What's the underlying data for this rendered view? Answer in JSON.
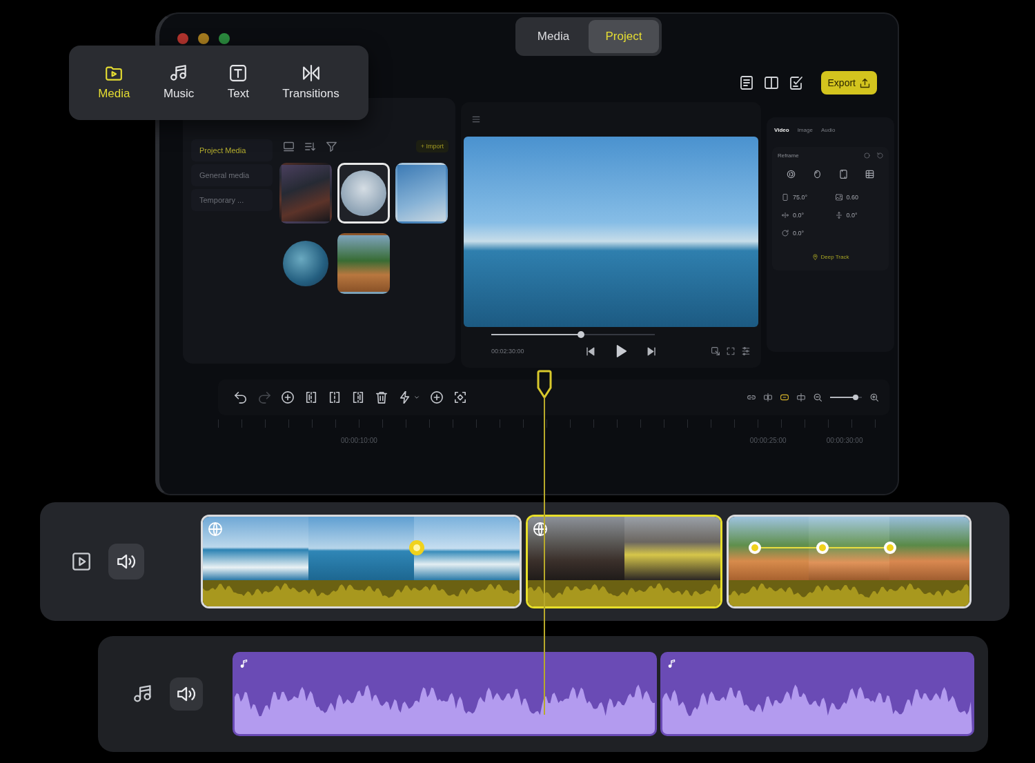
{
  "window": {
    "buttons": [
      {
        "color": "#b3342e"
      },
      {
        "color": "#a67c1f"
      },
      {
        "color": "#2b8a3e"
      }
    ]
  },
  "view_switch": [
    {
      "label": "Media",
      "selected": false
    },
    {
      "label": "Project",
      "selected": true
    }
  ],
  "category_tabs": [
    {
      "label": "Media",
      "selected": true
    },
    {
      "label": "Music",
      "selected": false
    },
    {
      "label": "Text",
      "selected": false
    },
    {
      "label": "Transitions",
      "selected": false
    }
  ],
  "toolbar": {
    "export": "Export"
  },
  "media_panel": {
    "folders": [
      {
        "label": "Project Media",
        "selected": true
      },
      {
        "label": "General media",
        "selected": false
      },
      {
        "label": "Temporary ...",
        "selected": false
      }
    ],
    "import": "+ Import",
    "thumbnails": [
      {
        "kind": "square",
        "selected": false
      },
      {
        "kind": "round",
        "selected": true
      },
      {
        "kind": "square",
        "selected": false
      },
      {
        "kind": "round",
        "selected": false
      },
      {
        "kind": "square",
        "selected": false
      }
    ]
  },
  "preview": {
    "progress": {
      "level": 0.55
    },
    "time": "00:02:30:00"
  },
  "inspector": {
    "tabs": [
      {
        "label": "Video",
        "selected": true
      },
      {
        "label": "Image",
        "selected": false
      },
      {
        "label": "Audio",
        "selected": false
      }
    ],
    "section": "Reframe",
    "values": [
      "75.0°",
      "0.60",
      "0.0°",
      "0.0°",
      "0.0°"
    ],
    "deep_track": "Deep Track"
  },
  "timeline": {
    "edit_tools": [
      {
        "disabled": false
      },
      {
        "disabled": true
      },
      {
        "disabled": false
      },
      {
        "disabled": false
      },
      {
        "disabled": false
      },
      {
        "disabled": false
      },
      {
        "disabled": false
      },
      {
        "disabled": false
      },
      {
        "disabled": false
      },
      {
        "disabled": false
      }
    ],
    "link_tools": [
      {
        "on": false
      },
      {
        "on": false
      },
      {
        "on": true
      },
      {
        "on": false
      }
    ],
    "zoom": {
      "level": 0.8
    },
    "ruler": [
      "00:00:10:00",
      "00:00:25:00",
      "00:00:30:00"
    ]
  },
  "video_track": {
    "clips": [
      {
        "kind": "spherical",
        "selected": false,
        "keyframes": [
          {
            "selected": true
          }
        ]
      },
      {
        "kind": "spherical",
        "selected": true
      },
      {
        "kind": "flat",
        "selected": false,
        "keyframes": [
          {
            "selected": false
          },
          {
            "selected": false
          },
          {
            "selected": false
          }
        ]
      }
    ]
  },
  "music_track": {
    "clips": [
      {
        "selected": false
      },
      {
        "selected": false
      }
    ]
  }
}
